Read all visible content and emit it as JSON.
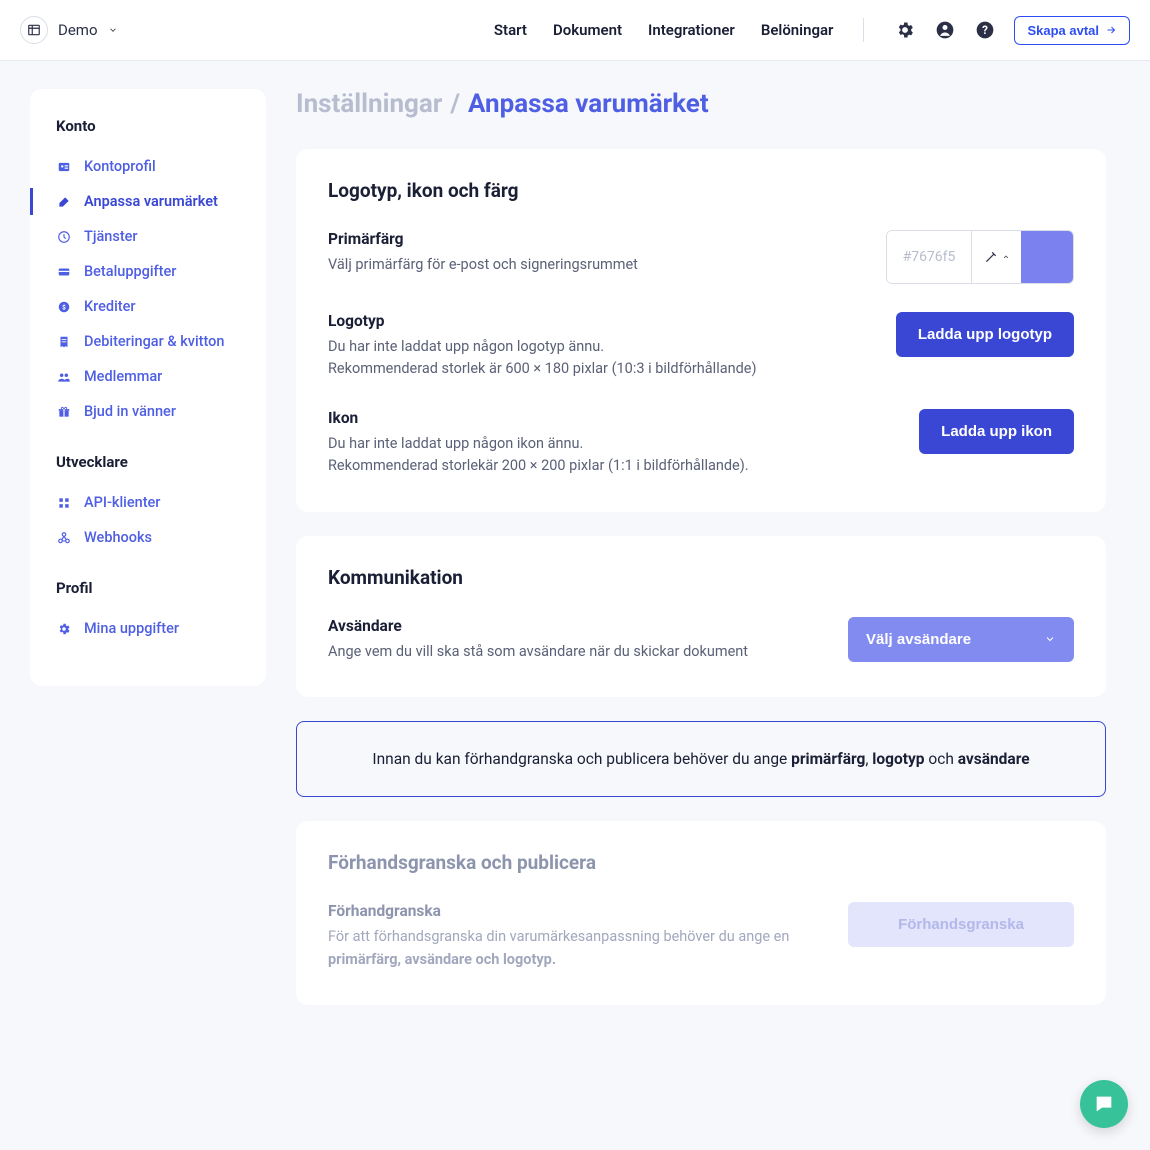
{
  "topbar": {
    "workspace": "Demo",
    "nav": [
      "Start",
      "Dokument",
      "Integrationer",
      "Belöningar"
    ],
    "create_label": "Skapa avtal"
  },
  "sidebar": {
    "groups": [
      {
        "title": "Konto",
        "items": [
          {
            "label": "Kontoprofil",
            "icon": "user-card",
            "active": false
          },
          {
            "label": "Anpassa varumärket",
            "icon": "brush",
            "active": true
          },
          {
            "label": "Tjänster",
            "icon": "clock",
            "active": false
          },
          {
            "label": "Betaluppgifter",
            "icon": "credit-card",
            "active": false
          },
          {
            "label": "Krediter",
            "icon": "coin",
            "active": false
          },
          {
            "label": "Debiteringar & kvitton",
            "icon": "receipt",
            "active": false
          },
          {
            "label": "Medlemmar",
            "icon": "members",
            "active": false
          },
          {
            "label": "Bjud in vänner",
            "icon": "gift",
            "active": false
          }
        ]
      },
      {
        "title": "Utvecklare",
        "items": [
          {
            "label": "API-klienter",
            "icon": "grid",
            "active": false
          },
          {
            "label": "Webhooks",
            "icon": "webhook",
            "active": false
          }
        ]
      },
      {
        "title": "Profil",
        "items": [
          {
            "label": "Mina uppgifter",
            "icon": "cog",
            "active": false
          }
        ]
      }
    ]
  },
  "breadcrumb": {
    "parent": "Inställningar",
    "sep": "/",
    "current": "Anpassa varumärket"
  },
  "cards": {
    "branding": {
      "title": "Logotyp, ikon och färg",
      "primary_color": {
        "label": "Primärfärg",
        "desc": "Välj primärfärg för e-post och signeringsrummet",
        "placeholder": "#7676f5",
        "swatch_hex": "#7b82ef"
      },
      "logo": {
        "label": "Logotyp",
        "desc_line1": "Du har inte laddat upp någon logotyp ännu.",
        "desc_line2": "Rekommenderad storlek är 600 × 180 pixlar (10:3 i bildförhållande)",
        "button": "Ladda upp logotyp"
      },
      "icon": {
        "label": "Ikon",
        "desc_line1": "Du har inte laddat upp någon ikon ännu.",
        "desc_line2": "Rekommenderad storlekär 200 × 200 pixlar (1:1 i bildförhållande).",
        "button": "Ladda upp ikon"
      }
    },
    "communication": {
      "title": "Kommunikation",
      "sender": {
        "label": "Avsändare",
        "desc": "Ange vem du vill ska stå som avsändare när du skickar dokument",
        "button": "Välj avsändare"
      }
    },
    "preview": {
      "title": "Förhandsgranska och publicera",
      "row": {
        "label": "Förhandgranska",
        "desc_prefix": "För att förhandsgranska din varumärkesanpassning behöver du ange en ",
        "desc_bold": "primärfärg, avsändare och logotyp.",
        "button": "Förhandsgranska"
      }
    }
  },
  "notice": {
    "prefix": "Innan du kan förhandgranska och publicera behöver du ange ",
    "b1": "primärfärg",
    "sep1": ", ",
    "b2": "logotyp",
    "sep2": " och ",
    "b3": "avsändare"
  }
}
